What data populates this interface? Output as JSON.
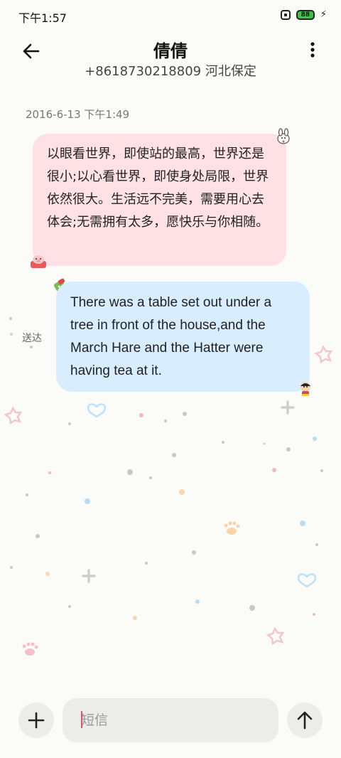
{
  "status_bar": {
    "time": "下午1:57",
    "battery": "88"
  },
  "header": {
    "contact_name": "倩倩",
    "contact_number": "+8618730218809 河北保定"
  },
  "conversation": {
    "timestamp": "2016-6-13 下午1:49",
    "incoming_message": "以眼看世界，即使站的最高，世界还是很小;以心看世界，即使身处局限，世界依然很大。生活远不完美，需要用心去体会;无需拥有太多，愿快乐与你相随。",
    "outgoing_message": "There was a table set out under a tree in front of the house,and the March Hare and the Hatter were having tea at it.",
    "delivery_status": "送达"
  },
  "composer": {
    "placeholder": "短信",
    "value": ""
  },
  "icons": {
    "back": "arrow-left-icon",
    "menu": "more-vertical-icon",
    "add": "plus-icon",
    "send": "arrow-up-icon"
  },
  "colors": {
    "incoming_bubble": "#fde1e5",
    "outgoing_bubble": "#d8edfd",
    "background": "#fbfbf8",
    "battery": "#38c54a"
  }
}
